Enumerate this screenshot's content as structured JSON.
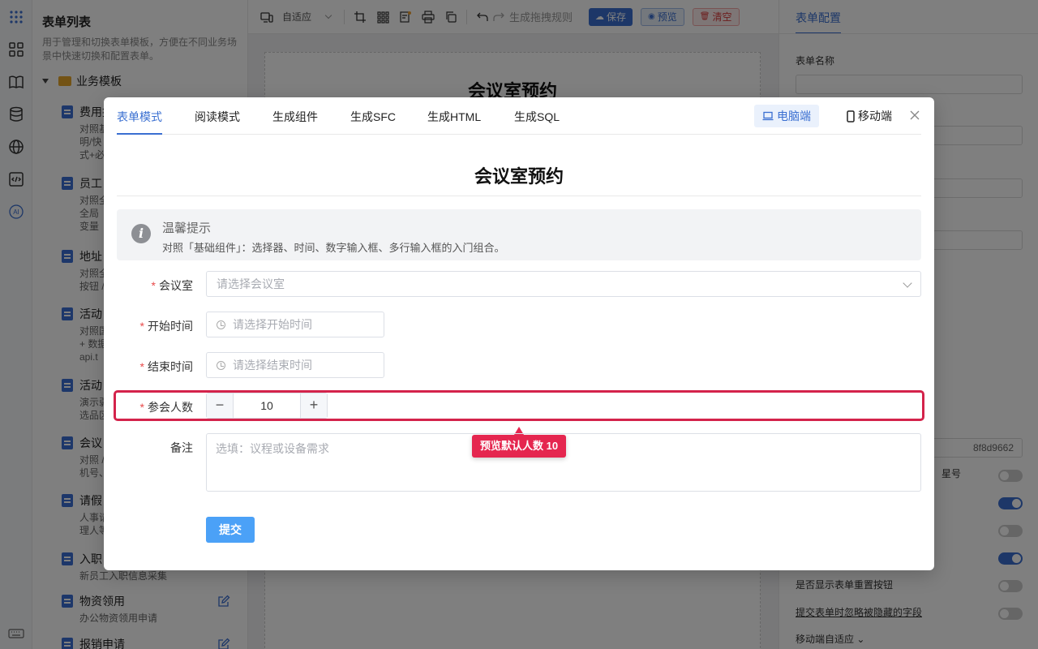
{
  "sidebar": {
    "title": "表单列表",
    "desc": "用于管理和切换表单模板，方便在不同业务场景中快速切换和配置表单。",
    "folder": "业务模板",
    "items": [
      {
        "name": "费用报",
        "sub": [
          "对照基",
          "明/快",
          "式+必"
        ]
      },
      {
        "name": "员工",
        "sub": [
          "对照全",
          "全局",
          "变量"
        ]
      },
      {
        "name": "地址",
        "sub": [
          "对照全",
          "按钮 /"
        ]
      },
      {
        "name": "活动",
        "sub": [
          "对照国",
          "+ 数据",
          "api.t"
        ]
      },
      {
        "name": "活动",
        "sub": [
          "演示弱",
          "选品区"
        ]
      },
      {
        "name": "会议",
        "sub": [
          "对照 /",
          "机号、"
        ]
      },
      {
        "name": "请假",
        "sub": [
          "人事请",
          "理人等"
        ]
      },
      {
        "name": "入职",
        "sub": [
          "新员工入职信息采集"
        ]
      },
      {
        "name": "物资领用",
        "sub": [
          "办公物资领用申请"
        ]
      },
      {
        "name": "报销申请",
        "sub": []
      }
    ]
  },
  "toolbar": {
    "adapt": "自适应",
    "rule": "生成拖拽规则",
    "save": "保存",
    "preview": "预览",
    "clear": "清空"
  },
  "canvas": {
    "title": "会议室预约"
  },
  "config": {
    "tab": "表单配置",
    "form_name_label": "表单名称",
    "id_value": "8f8d9662",
    "star_label": "星号",
    "reset_label": "是否显示表单重置按钮",
    "ignore_label": "提交表单时忽略被隐藏的字段",
    "mobile_label": "移动端自适应"
  },
  "modal": {
    "tabs": [
      "表单模式",
      "阅读模式",
      "生成组件",
      "生成SFC",
      "生成HTML",
      "生成SQL"
    ],
    "pc": "电脑端",
    "mobile": "移动端",
    "form_title": "会议室预约",
    "alert_title": "温馨提示",
    "alert_desc": "对照「基础组件」：选择器、时间、数字输入框、多行输入框的入门组合。",
    "fields": {
      "room": {
        "label": "会议室",
        "placeholder": "请选择会议室"
      },
      "start": {
        "label": "开始时间",
        "placeholder": "请选择开始时间"
      },
      "end": {
        "label": "结束时间",
        "placeholder": "请选择结束时间"
      },
      "count": {
        "label": "参会人数",
        "value": "10"
      },
      "note": {
        "label": "备注",
        "placeholder": "选填：议程或设备需求"
      }
    },
    "tip": "预览默认人数 10",
    "submit": "提交"
  },
  "colors": {
    "accent": "#3a6fd1",
    "highlight": "#d4234b"
  }
}
